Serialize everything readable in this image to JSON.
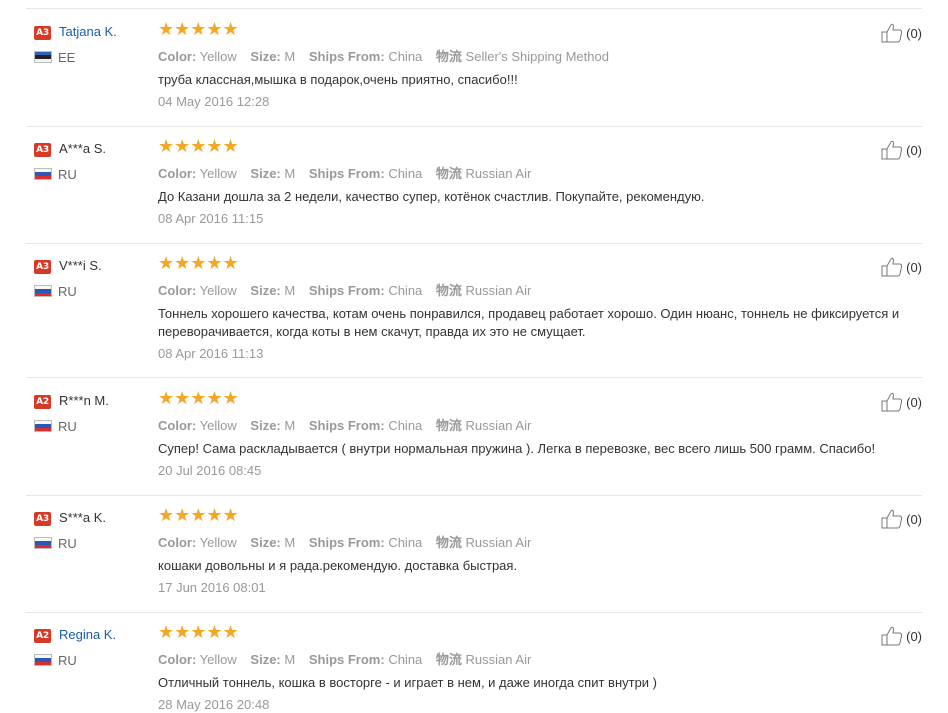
{
  "reviews": [
    {
      "level": "A3",
      "name": "Tatjana K.",
      "name_is_link": true,
      "flag": "EE",
      "country": "EE",
      "rating": 5,
      "meta": {
        "color_label": "Color:",
        "color": "Yellow",
        "size_label": "Size:",
        "size": "M",
        "ships_label": "Ships From:",
        "ships": "China",
        "shipping_label": "物流",
        "shipping": "Seller's Shipping Method"
      },
      "text": "труба классная,мышка в подарок,очень приятно, спасибо!!!",
      "date": "04 May 2016 12:28",
      "helpful_count": "(0)"
    },
    {
      "level": "A3",
      "name": "A***a S.",
      "name_is_link": false,
      "flag": "RU",
      "country": "RU",
      "rating": 5,
      "meta": {
        "color_label": "Color:",
        "color": "Yellow",
        "size_label": "Size:",
        "size": "M",
        "ships_label": "Ships From:",
        "ships": "China",
        "shipping_label": "物流",
        "shipping": "Russian Air"
      },
      "text": "До Казани дошла за 2 недели, качество супер, котёнок счастлив. Покупайте, рекомендую.",
      "date": "08 Apr 2016 11:15",
      "helpful_count": "(0)"
    },
    {
      "level": "A3",
      "name": "V***i S.",
      "name_is_link": false,
      "flag": "RU",
      "country": "RU",
      "rating": 5,
      "meta": {
        "color_label": "Color:",
        "color": "Yellow",
        "size_label": "Size:",
        "size": "M",
        "ships_label": "Ships From:",
        "ships": "China",
        "shipping_label": "物流",
        "shipping": "Russian Air"
      },
      "text": "Тоннель хорошего качества, котам очень понравился, продавец работает хорошо. Один нюанс, тоннель не фиксируется и переворачивается, когда коты в нем скачут, правда их это не смущает.",
      "date": "08 Apr 2016 11:13",
      "helpful_count": "(0)"
    },
    {
      "level": "A2",
      "name": "R***n M.",
      "name_is_link": false,
      "flag": "RU",
      "country": "RU",
      "rating": 5,
      "meta": {
        "color_label": "Color:",
        "color": "Yellow",
        "size_label": "Size:",
        "size": "M",
        "ships_label": "Ships From:",
        "ships": "China",
        "shipping_label": "物流",
        "shipping": "Russian Air"
      },
      "text": "Супер! Сама раскладывается ( внутри нормальная пружина ). Легка в перевозке, вес всего лишь 500 грамм. Спасибо!",
      "date": "20 Jul 2016 08:45",
      "helpful_count": "(0)"
    },
    {
      "level": "A3",
      "name": "S***a K.",
      "name_is_link": false,
      "flag": "RU",
      "country": "RU",
      "rating": 5,
      "meta": {
        "color_label": "Color:",
        "color": "Yellow",
        "size_label": "Size:",
        "size": "M",
        "ships_label": "Ships From:",
        "ships": "China",
        "shipping_label": "物流",
        "shipping": "Russian Air"
      },
      "text": "кошаки довольны и я рада.рекомендую. доставка быстрая.",
      "date": "17 Jun 2016 08:01",
      "helpful_count": "(0)"
    },
    {
      "level": "A2",
      "name": "Regina K.",
      "name_is_link": true,
      "flag": "RU",
      "country": "RU",
      "rating": 5,
      "meta": {
        "color_label": "Color:",
        "color": "Yellow",
        "size_label": "Size:",
        "size": "M",
        "ships_label": "Ships From:",
        "ships": "China",
        "shipping_label": "物流",
        "shipping": "Russian Air"
      },
      "text": "Отличный тоннель, кошка в восторге - и играет в нем, и даже иногда спит внутри )",
      "date": "28 May 2016 20:48",
      "helpful_count": "(0)"
    }
  ],
  "colors": {
    "star": "#f5a623",
    "level_badge": "#d63a27",
    "link_name": "#1a5ea8",
    "muted": "#999999"
  },
  "icons": {
    "helpful": "thumbs-up-icon",
    "star": "star-icon"
  }
}
